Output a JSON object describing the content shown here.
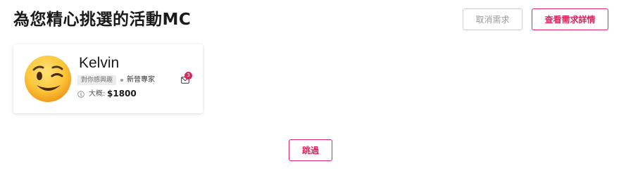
{
  "header": {
    "title": "為您精心挑選的活動MC",
    "cancel_label": "取消需求",
    "details_label": "查看需求詳情"
  },
  "mc_card": {
    "avatar_icon": "winking-face-emoji",
    "name": "Kelvin",
    "tag": "對你感興趣",
    "expert_label": "新晉專家",
    "price_prefix": "大概:",
    "price_value": "$1800",
    "message_badge_count": "3"
  },
  "footer": {
    "skip_label": "跳過"
  },
  "colors": {
    "accent": "#e0245e",
    "muted_border": "#cfcfcf",
    "muted_text": "#9a9a9a",
    "tag_bg": "#ececec"
  }
}
